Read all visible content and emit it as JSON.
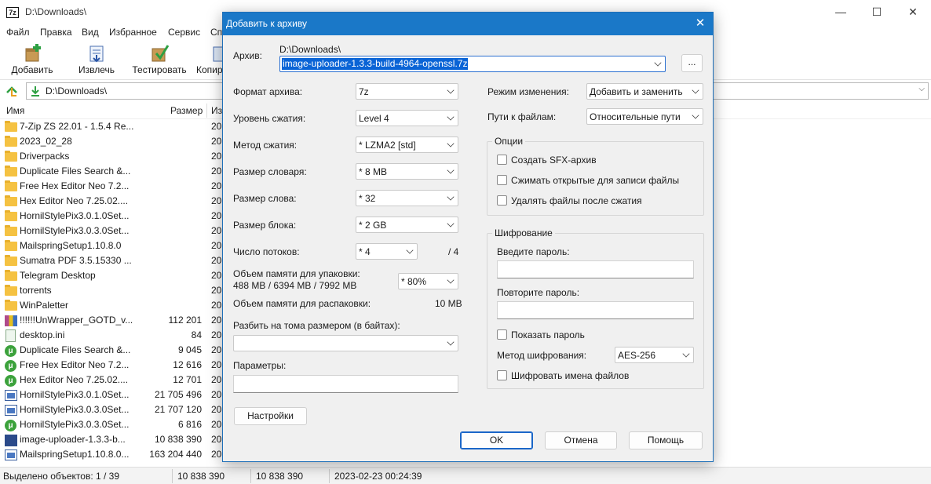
{
  "window": {
    "title": "D:\\Downloads\\",
    "app_icon": "7z",
    "minimize": "—",
    "maximize": "☐",
    "close": "✕"
  },
  "menu": [
    "Файл",
    "Правка",
    "Вид",
    "Избранное",
    "Сервис",
    "Сп"
  ],
  "toolbar": {
    "add": "Добавить",
    "extract": "Извлечь",
    "test": "Тестировать",
    "copy": "Копир"
  },
  "address": {
    "path": "D:\\Downloads\\"
  },
  "columns": {
    "name": "Имя",
    "size": "Размер",
    "modified": "Из"
  },
  "files": [
    {
      "name": "7-Zip ZS 22.01 - 1.5.4 Re...",
      "size": "",
      "date": "20",
      "icon": "folder-icon"
    },
    {
      "name": "2023_02_28",
      "size": "",
      "date": "20",
      "icon": "folder-icon"
    },
    {
      "name": "Driverpacks",
      "size": "",
      "date": "20",
      "icon": "folder-icon"
    },
    {
      "name": "Duplicate Files Search &...",
      "size": "",
      "date": "20",
      "icon": "folder-icon"
    },
    {
      "name": "Free Hex Editor Neo 7.2...",
      "size": "",
      "date": "20",
      "icon": "folder-icon"
    },
    {
      "name": "Hex Editor Neo 7.25.02....",
      "size": "",
      "date": "20",
      "icon": "folder-icon"
    },
    {
      "name": "HornilStylePix3.0.1.0Set...",
      "size": "",
      "date": "20",
      "icon": "folder-icon"
    },
    {
      "name": "HornilStylePix3.0.3.0Set...",
      "size": "",
      "date": "20",
      "icon": "folder-icon"
    },
    {
      "name": "MailspringSetup1.10.8.0",
      "size": "",
      "date": "20",
      "icon": "folder-icon"
    },
    {
      "name": "Sumatra PDF 3.5.15330 ...",
      "size": "",
      "date": "20",
      "icon": "folder-icon"
    },
    {
      "name": "Telegram Desktop",
      "size": "",
      "date": "20",
      "icon": "folder-icon"
    },
    {
      "name": "torrents",
      "size": "",
      "date": "20",
      "icon": "folder-icon"
    },
    {
      "name": "WinPaletter",
      "size": "",
      "date": "20",
      "icon": "folder-icon"
    },
    {
      "name": "!!!!!!UnWrapper_GOTD_v...",
      "size": "112 201",
      "date": "20",
      "icon": "rar-icon"
    },
    {
      "name": "desktop.ini",
      "size": "84",
      "date": "20",
      "icon": "ini-file-icon"
    },
    {
      "name": "Duplicate Files Search &...",
      "size": "9 045",
      "date": "20",
      "icon": "torrent-icon"
    },
    {
      "name": "Free Hex Editor Neo 7.2...",
      "size": "12 616",
      "date": "20",
      "icon": "torrent-icon"
    },
    {
      "name": "Hex Editor Neo 7.25.02....",
      "size": "12 701",
      "date": "20",
      "icon": "torrent-icon"
    },
    {
      "name": "HornilStylePix3.0.1.0Set...",
      "size": "21 705 496",
      "date": "20",
      "icon": "exe-icon"
    },
    {
      "name": "HornilStylePix3.0.3.0Set...",
      "size": "21 707 120",
      "date": "20",
      "icon": "exe-icon"
    },
    {
      "name": "HornilStylePix3.0.3.0Set...",
      "size": "6 816",
      "date": "20",
      "icon": "torrent-icon"
    },
    {
      "name": "image-uploader-1.3.3-b...",
      "size": "10 838 390",
      "date": "20",
      "icon": "7z-archive-icon"
    },
    {
      "name": "MailspringSetup1.10.8.0...",
      "size": "163 204 440",
      "date": "20",
      "icon": "exe-icon"
    }
  ],
  "status": {
    "selected": "Выделено объектов: 1 / 39",
    "size1": "10 838 390",
    "size2": "10 838 390",
    "datetime": "2023-02-23 00:24:39"
  },
  "dialog": {
    "title": "Добавить к архиву",
    "close": "✕",
    "archive_label": "Архив:",
    "archive_dir": "D:\\Downloads\\",
    "archive_name": "image-uploader-1.3.3-build-4964-openssl.7z",
    "browse": "...",
    "format_label": "Формат архива:",
    "format_value": "7z",
    "level_label": "Уровень сжатия:",
    "level_value": "Level 4",
    "method_label": "Метод сжатия:",
    "method_value": "*  LZMA2 [std]",
    "dict_label": "Размер словаря:",
    "dict_value": "*  8 MB",
    "word_label": "Размер слова:",
    "word_value": "*  32",
    "block_label": "Размер блока:",
    "block_value": "*  2 GB",
    "threads_label": "Число потоков:",
    "threads_value": "*  4",
    "threads_max": "/ 4",
    "mem_pack_label": "Объем памяти для упаковки:",
    "mem_pack_value": "488 MB / 6394 MB / 7992 MB",
    "mem_pack_percent": "* 80%",
    "mem_unpack_label": "Объем памяти для распаковки:",
    "mem_unpack_value": "10 MB",
    "split_label": "Разбить на тома размером (в байтах):",
    "split_value": "",
    "params_label": "Параметры:",
    "params_value": "",
    "settings_btn": "Настройки",
    "update_label": "Режим изменения:",
    "update_value": "Добавить и заменить",
    "paths_label": "Пути к файлам:",
    "paths_value": "Относительные пути",
    "options_title": "Опции",
    "opt_sfx": "Создать SFX-архив",
    "opt_shared": "Сжимать открытые для записи файлы",
    "opt_delete": "Удалять файлы после сжатия",
    "enc_title": "Шифрование",
    "enc_pass_label": "Введите пароль:",
    "enc_pass_value": "",
    "enc_repeat_label": "Повторите пароль:",
    "enc_repeat_value": "",
    "enc_show": "Показать пароль",
    "enc_method_label": "Метод шифрования:",
    "enc_method_value": "AES-256",
    "enc_names": "Шифровать имена файлов",
    "ok": "OK",
    "cancel": "Отмена",
    "help": "Помощь"
  },
  "colors": {
    "dialog_title_bg": "#1a78c8",
    "selection": "#0a64d6",
    "folder": "#f5c242"
  }
}
